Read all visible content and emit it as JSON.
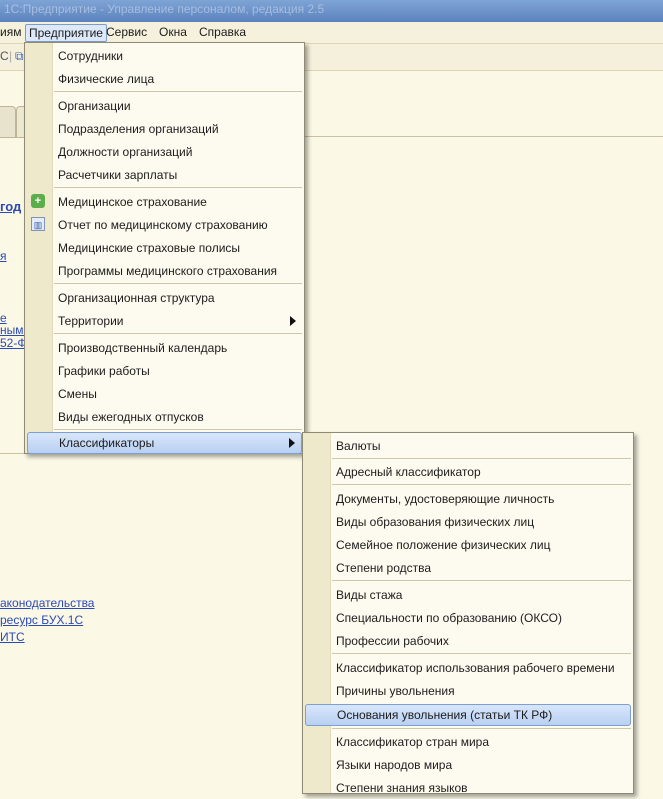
{
  "window": {
    "title": "1С:Предприятие - Управление персоналом, редакция 2.5"
  },
  "menubar": {
    "items": [
      "иям",
      "Предприятие",
      "Сервис",
      "Окна",
      "Справка"
    ]
  },
  "toolbar": {
    "glyphs": [
      "С",
      "|",
      "⧉"
    ]
  },
  "background": {
    "links": [
      "год",
      "я",
      "е",
      "ными",
      "52-Ф",
      "аконодательства",
      "ресурс БУХ.1С",
      "ИТС"
    ]
  },
  "menu_enterprise": {
    "items": [
      "Сотрудники",
      "Физические лица",
      "Организации",
      "Подразделения организаций",
      "Должности организаций",
      "Расчетчики зарплаты",
      "Медицинское страхование",
      "Отчет по медицинскому страхованию",
      "Медицинские страховые полисы",
      "Программы медицинского страхования",
      "Организационная структура",
      "Территории",
      "Производственный календарь",
      "Графики работы",
      "Смены",
      "Виды ежегодных отпусков",
      "Классификаторы"
    ],
    "icons": {
      "medical_insurance": "plus-shield-icon",
      "medical_report": "report-chart-icon"
    }
  },
  "menu_classifiers": {
    "items": [
      "Валюты",
      "Адресный классификатор",
      "Документы, удостоверяющие личность",
      "Виды образования физических лиц",
      "Семейное положение физических лиц",
      "Степени родства",
      "Виды стажа",
      "Специальности по образованию (ОКСО)",
      "Профессии рабочих",
      "Классификатор использования рабочего времени",
      "Причины увольнения",
      "Основания увольнения (статьи ТК РФ)",
      "Классификатор стран мира",
      "Языки народов мира",
      "Степени знания языков"
    ]
  },
  "colors": {
    "highlight": "#b9d0f2",
    "link": "#2b49b8",
    "background": "#fbf8e6"
  }
}
